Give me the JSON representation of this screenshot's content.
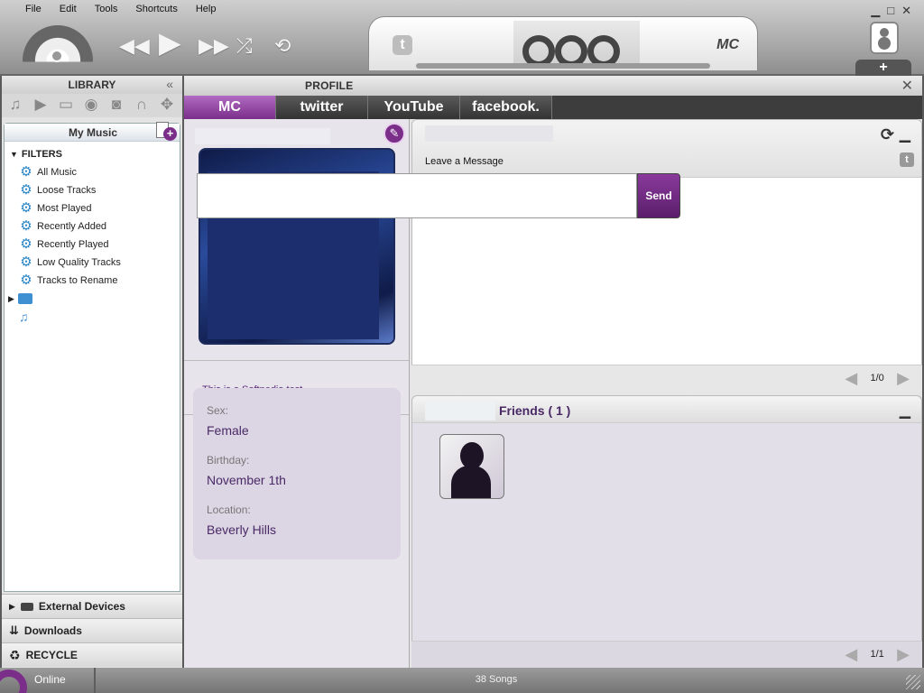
{
  "menu": [
    "File",
    "Edit",
    "Tools",
    "Shortcuts",
    "Help"
  ],
  "window_controls": {
    "minimize": "▁",
    "maximize": "□",
    "close": "✕"
  },
  "transport": {
    "rewind": "◀◀",
    "play": "▶",
    "forward": "▶▶",
    "shuffle": "⤮",
    "repeat": "⟲"
  },
  "center": {
    "twitter_glyph": "t",
    "mc_label": "MC"
  },
  "add_label": "+",
  "library": {
    "title": "LIBRARY",
    "collapse": "«",
    "icons": [
      "music-icon",
      "video-icon",
      "folder-icon",
      "podcast-icon",
      "camera-icon",
      "headphones-icon",
      "gamepad-icon"
    ],
    "my_music": "My Music",
    "filters_label": "FILTERS",
    "filters": [
      "All Music",
      "Loose Tracks",
      "Most Played",
      "Recently Added",
      "Recently Played",
      "Low Quality Tracks",
      "Tracks to Rename"
    ],
    "sections": [
      "External Devices",
      "Downloads",
      "RECYCLE"
    ]
  },
  "profile": {
    "title": "PROFILE",
    "close": "✕",
    "tabs": [
      "MC",
      "twitter",
      "YouTube",
      "facebook."
    ],
    "status_text": "This is a Softpedia test",
    "info": [
      {
        "label": "Sex:",
        "value": "Female"
      },
      {
        "label": "Birthday:",
        "value": "November 1th"
      },
      {
        "label": "Location:",
        "value": "Beverly Hills"
      }
    ]
  },
  "message": {
    "label": "Leave a Message",
    "input_value": "",
    "send": "Send",
    "page": "1/0"
  },
  "friends": {
    "title": "Friends ( 1 )",
    "page": "1/1"
  },
  "statusbar": {
    "online": "Online",
    "songs": "38 Songs"
  },
  "colors": {
    "accent": "#7a2e8a",
    "link": "#5b2a7a",
    "gear": "#2a86c6"
  }
}
